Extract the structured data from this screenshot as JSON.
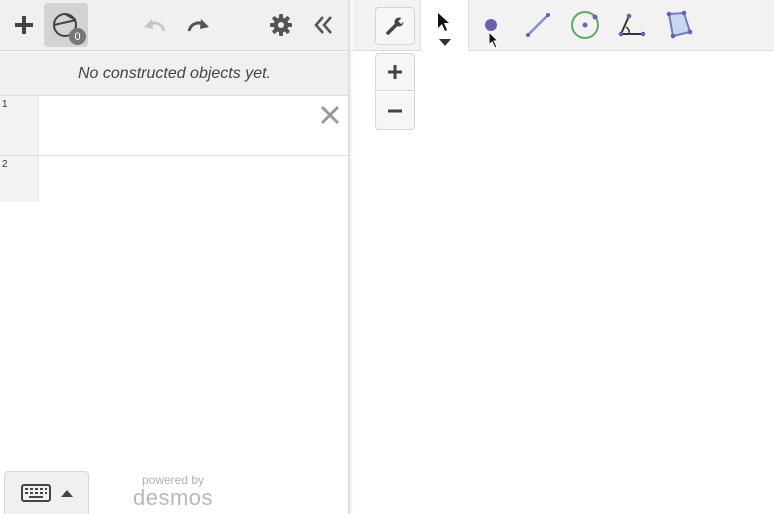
{
  "left_toolbar": {
    "object_count": "0"
  },
  "constructed": {
    "empty_message": "No constructed objects yet."
  },
  "expressions": [
    {
      "index": "1"
    },
    {
      "index": "2"
    }
  ],
  "powered": {
    "prefix": "powered by",
    "brand": "desmos"
  },
  "icons": {
    "add": "plus-icon",
    "objects": "geometry-objects-icon",
    "undo": "undo-icon",
    "redo": "redo-icon",
    "settings": "gear-icon",
    "collapse": "double-chevron-left-icon",
    "select": "arrow-pointer-icon",
    "point": "point-tool-icon",
    "segment": "segment-tool-icon",
    "circle": "circle-tool-icon",
    "angle": "angle-tool-icon",
    "polygon": "polygon-tool-icon",
    "wrench": "wrench-icon",
    "zoom_in": "plus-icon",
    "zoom_out": "minus-icon",
    "keyboard": "keyboard-icon"
  },
  "colors": {
    "accent_purple": "#6b5fb5",
    "circle_green": "#5fa85f",
    "icon_dark": "#4a4a4a",
    "icon_disabled": "#c8c8c8"
  }
}
